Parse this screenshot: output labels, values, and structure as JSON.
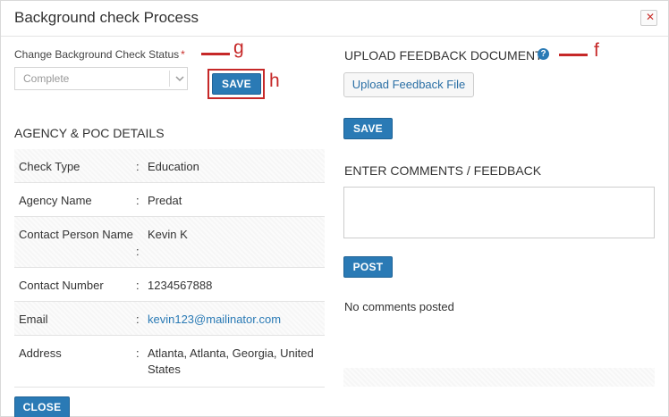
{
  "modal": {
    "title": "Background check Process",
    "close_icon": "close-icon"
  },
  "status": {
    "label": "Change Background Check Status",
    "required_mark": "*",
    "selected": "Complete",
    "save_label": "SAVE"
  },
  "annotations": {
    "g": "g",
    "h": "h",
    "f": "f",
    "color": "#c62828"
  },
  "agency": {
    "section_title": "AGENCY & POC DETAILS",
    "separator": ":",
    "rows": [
      {
        "label": "Check Type",
        "value": "Education"
      },
      {
        "label": "Agency Name",
        "value": "Predat"
      },
      {
        "label": "Contact Person Name",
        "value": "Kevin K"
      },
      {
        "label": "Contact Number",
        "value": "1234567888"
      },
      {
        "label": "Email",
        "value": "kevin123@mailinator.com"
      },
      {
        "label": "Address",
        "value_line1": "Atlanta, Atlanta, Georgia, United",
        "value_line2": "States"
      }
    ]
  },
  "upload": {
    "section_title": "UPLOAD FEEDBACK DOCUMENT",
    "help_icon": "help-icon",
    "help_glyph": "?",
    "button_label": "Upload Feedback File",
    "save_label": "SAVE"
  },
  "comments": {
    "section_title": "ENTER COMMENTS / FEEDBACK",
    "post_label": "POST",
    "empty_text": "No comments posted"
  },
  "footer": {
    "close_label": "CLOSE"
  },
  "colors": {
    "accent": "#2a7ab5",
    "annotation": "#c62828"
  }
}
